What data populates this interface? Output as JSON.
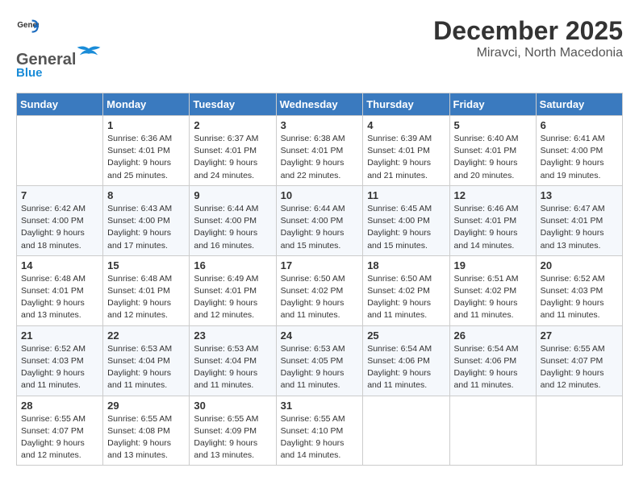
{
  "header": {
    "logo_general": "General",
    "logo_blue": "Blue",
    "month_year": "December 2025",
    "location": "Miravci, North Macedonia"
  },
  "days_of_week": [
    "Sunday",
    "Monday",
    "Tuesday",
    "Wednesday",
    "Thursday",
    "Friday",
    "Saturday"
  ],
  "weeks": [
    [
      {
        "day": "",
        "info": ""
      },
      {
        "day": "1",
        "info": "Sunrise: 6:36 AM\nSunset: 4:01 PM\nDaylight: 9 hours\nand 25 minutes."
      },
      {
        "day": "2",
        "info": "Sunrise: 6:37 AM\nSunset: 4:01 PM\nDaylight: 9 hours\nand 24 minutes."
      },
      {
        "day": "3",
        "info": "Sunrise: 6:38 AM\nSunset: 4:01 PM\nDaylight: 9 hours\nand 22 minutes."
      },
      {
        "day": "4",
        "info": "Sunrise: 6:39 AM\nSunset: 4:01 PM\nDaylight: 9 hours\nand 21 minutes."
      },
      {
        "day": "5",
        "info": "Sunrise: 6:40 AM\nSunset: 4:01 PM\nDaylight: 9 hours\nand 20 minutes."
      },
      {
        "day": "6",
        "info": "Sunrise: 6:41 AM\nSunset: 4:00 PM\nDaylight: 9 hours\nand 19 minutes."
      }
    ],
    [
      {
        "day": "7",
        "info": "Sunrise: 6:42 AM\nSunset: 4:00 PM\nDaylight: 9 hours\nand 18 minutes."
      },
      {
        "day": "8",
        "info": "Sunrise: 6:43 AM\nSunset: 4:00 PM\nDaylight: 9 hours\nand 17 minutes."
      },
      {
        "day": "9",
        "info": "Sunrise: 6:44 AM\nSunset: 4:00 PM\nDaylight: 9 hours\nand 16 minutes."
      },
      {
        "day": "10",
        "info": "Sunrise: 6:44 AM\nSunset: 4:00 PM\nDaylight: 9 hours\nand 15 minutes."
      },
      {
        "day": "11",
        "info": "Sunrise: 6:45 AM\nSunset: 4:00 PM\nDaylight: 9 hours\nand 15 minutes."
      },
      {
        "day": "12",
        "info": "Sunrise: 6:46 AM\nSunset: 4:01 PM\nDaylight: 9 hours\nand 14 minutes."
      },
      {
        "day": "13",
        "info": "Sunrise: 6:47 AM\nSunset: 4:01 PM\nDaylight: 9 hours\nand 13 minutes."
      }
    ],
    [
      {
        "day": "14",
        "info": "Sunrise: 6:48 AM\nSunset: 4:01 PM\nDaylight: 9 hours\nand 13 minutes."
      },
      {
        "day": "15",
        "info": "Sunrise: 6:48 AM\nSunset: 4:01 PM\nDaylight: 9 hours\nand 12 minutes."
      },
      {
        "day": "16",
        "info": "Sunrise: 6:49 AM\nSunset: 4:01 PM\nDaylight: 9 hours\nand 12 minutes."
      },
      {
        "day": "17",
        "info": "Sunrise: 6:50 AM\nSunset: 4:02 PM\nDaylight: 9 hours\nand 11 minutes."
      },
      {
        "day": "18",
        "info": "Sunrise: 6:50 AM\nSunset: 4:02 PM\nDaylight: 9 hours\nand 11 minutes."
      },
      {
        "day": "19",
        "info": "Sunrise: 6:51 AM\nSunset: 4:02 PM\nDaylight: 9 hours\nand 11 minutes."
      },
      {
        "day": "20",
        "info": "Sunrise: 6:52 AM\nSunset: 4:03 PM\nDaylight: 9 hours\nand 11 minutes."
      }
    ],
    [
      {
        "day": "21",
        "info": "Sunrise: 6:52 AM\nSunset: 4:03 PM\nDaylight: 9 hours\nand 11 minutes."
      },
      {
        "day": "22",
        "info": "Sunrise: 6:53 AM\nSunset: 4:04 PM\nDaylight: 9 hours\nand 11 minutes."
      },
      {
        "day": "23",
        "info": "Sunrise: 6:53 AM\nSunset: 4:04 PM\nDaylight: 9 hours\nand 11 minutes."
      },
      {
        "day": "24",
        "info": "Sunrise: 6:53 AM\nSunset: 4:05 PM\nDaylight: 9 hours\nand 11 minutes."
      },
      {
        "day": "25",
        "info": "Sunrise: 6:54 AM\nSunset: 4:06 PM\nDaylight: 9 hours\nand 11 minutes."
      },
      {
        "day": "26",
        "info": "Sunrise: 6:54 AM\nSunset: 4:06 PM\nDaylight: 9 hours\nand 11 minutes."
      },
      {
        "day": "27",
        "info": "Sunrise: 6:55 AM\nSunset: 4:07 PM\nDaylight: 9 hours\nand 12 minutes."
      }
    ],
    [
      {
        "day": "28",
        "info": "Sunrise: 6:55 AM\nSunset: 4:07 PM\nDaylight: 9 hours\nand 12 minutes."
      },
      {
        "day": "29",
        "info": "Sunrise: 6:55 AM\nSunset: 4:08 PM\nDaylight: 9 hours\nand 13 minutes."
      },
      {
        "day": "30",
        "info": "Sunrise: 6:55 AM\nSunset: 4:09 PM\nDaylight: 9 hours\nand 13 minutes."
      },
      {
        "day": "31",
        "info": "Sunrise: 6:55 AM\nSunset: 4:10 PM\nDaylight: 9 hours\nand 14 minutes."
      },
      {
        "day": "",
        "info": ""
      },
      {
        "day": "",
        "info": ""
      },
      {
        "day": "",
        "info": ""
      }
    ]
  ]
}
